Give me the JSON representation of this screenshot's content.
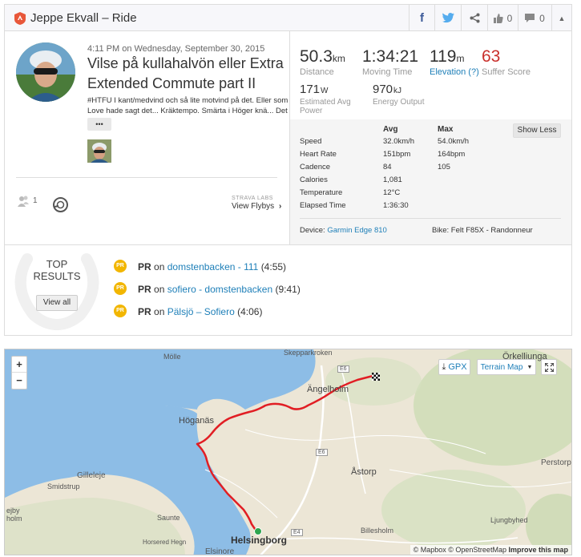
{
  "header": {
    "title": "Jeppe Ekvall – Ride",
    "kudos_count": "0",
    "comments_count": "0"
  },
  "activity": {
    "datetime": "4:11 PM on Wednesday, September 30, 2015",
    "title_line1": "Vilse på kullahalvön eller Extra",
    "title_line2": "Extended Commute part II",
    "desc_line1": "#HTFU I kant/medvind och så lite motvind på det. Eller som",
    "desc_line2": "Love hade sagt det... Kräktempo. Smärta i Höger knä... Det",
    "more_label": "•••",
    "athletes_count": "1",
    "strava_labs": "STRAVA LABS",
    "flyby_label": "View Flybys"
  },
  "stats": {
    "distance_value": "50.3",
    "distance_unit": "km",
    "distance_label": "Distance",
    "moving_time_value": "1:34:21",
    "moving_time_label": "Moving Time",
    "elevation_value": "119",
    "elevation_unit": "m",
    "elevation_label": "Elevation (?)",
    "suffer_value": "63",
    "suffer_label": "Suffer Score",
    "power_value": "171",
    "power_unit": "W",
    "power_label_1": "Estimated Avg",
    "power_label_2": "Power",
    "energy_value": "970",
    "energy_unit": "kJ",
    "energy_label": "Energy Output"
  },
  "details": {
    "col_avg": "Avg",
    "col_max": "Max",
    "show_less": "Show Less",
    "rows": [
      {
        "label": "Speed",
        "avg": "32.0",
        "avg_unit": "km/h",
        "max": "54.0",
        "max_unit": "km/h"
      },
      {
        "label": "Heart Rate",
        "avg": "151",
        "avg_unit": "bpm",
        "max": "164",
        "max_unit": "bpm"
      },
      {
        "label": "Cadence",
        "avg": "84",
        "avg_unit": "",
        "max": "105",
        "max_unit": ""
      },
      {
        "label": "Calories",
        "avg": "1,081",
        "avg_unit": "",
        "max": "",
        "max_unit": ""
      },
      {
        "label": "Temperature",
        "avg": "12",
        "avg_unit": "°C",
        "max": "",
        "max_unit": ""
      },
      {
        "label": "Elapsed Time",
        "avg": "1:36:30",
        "avg_unit": "",
        "max": "",
        "max_unit": ""
      }
    ],
    "device_label": "Device:",
    "device_value": "Garmin Edge 810",
    "bike_label": "Bike:",
    "bike_value": "Felt F85X - Randonneur"
  },
  "top_results": {
    "title_1": "TOP",
    "title_2": "RESULTS",
    "view_all": "View all",
    "medal_text": "PR",
    "items": [
      {
        "pr": "PR",
        "on": "on",
        "segment": "domstenbacken - 111",
        "time": "(4:55)"
      },
      {
        "pr": "PR",
        "on": "on",
        "segment": "sofiero - domstenbacken",
        "time": "(9:41)"
      },
      {
        "pr": "PR",
        "on": "on",
        "segment": "Pälsjö – Sofiero",
        "time": "(4:06)"
      }
    ]
  },
  "map": {
    "gpx_label": "GPX",
    "terrain_label": "Terrain Map",
    "zoom_in": "+",
    "zoom_out": "−",
    "attribution_mapbox": "© Mapbox",
    "attribution_osm": "© OpenStreetMap",
    "attribution_improve": "Improve this map",
    "places": {
      "molle": "Mölle",
      "skepparkroken": "Skepparkroken",
      "orkelljunga": "Örkelljunga",
      "angelholm": "Ängelholm",
      "hoganas": "Höganäs",
      "gilleleje": "Gilleleje",
      "smidstrup": "Smidstrup",
      "astorp": "Åstorp",
      "perstorp": "Perstorp",
      "saunte": "Saunte",
      "ljungbyhed": "Ljungbyhed",
      "billesholm": "Billesholm",
      "helsingborg": "Helsingborg",
      "elsinore": "Elsinore",
      "horsered": "Horsered Hegn",
      "ejby": "ejby",
      "holm": "holm",
      "e6a": "E6",
      "e6b": "E6",
      "e4": "E4"
    }
  }
}
